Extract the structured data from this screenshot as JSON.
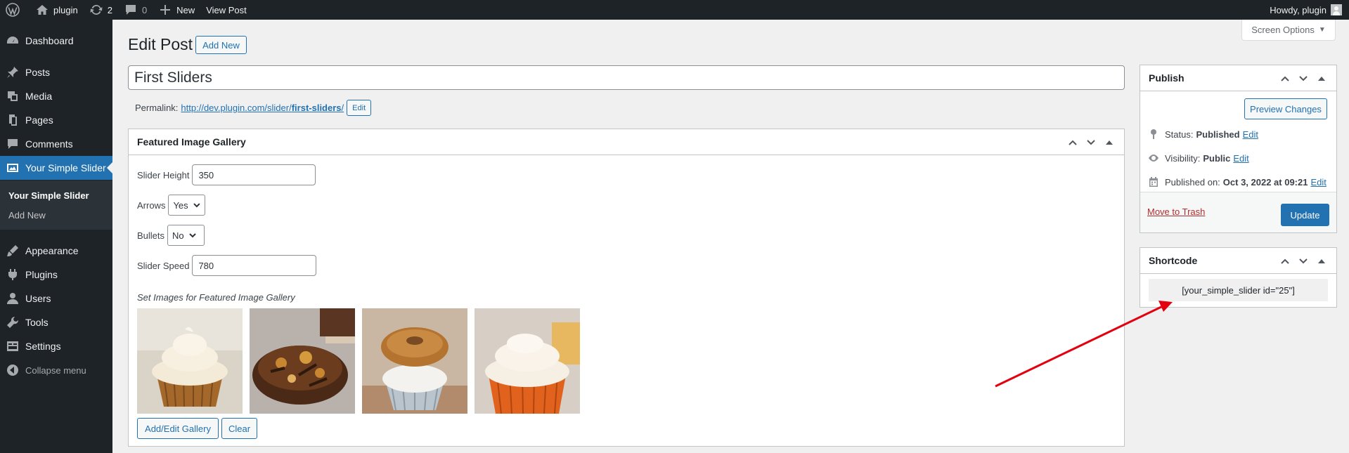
{
  "adminbar": {
    "site_name": "plugin",
    "updates_count": "2",
    "comments_count": "0",
    "new_label": "New",
    "view_post_label": "View Post",
    "howdy": "Howdy, plugin"
  },
  "sidebar": {
    "items": [
      {
        "label": "Dashboard",
        "icon": "dashboard-icon"
      },
      {
        "label": "Posts",
        "icon": "pin-icon"
      },
      {
        "label": "Media",
        "icon": "media-icon"
      },
      {
        "label": "Pages",
        "icon": "page-icon"
      },
      {
        "label": "Comments",
        "icon": "comment-icon"
      },
      {
        "label": "Your Simple Slider",
        "icon": "slider-icon",
        "current": true
      },
      {
        "label": "Appearance",
        "icon": "brush-icon"
      },
      {
        "label": "Plugins",
        "icon": "plugin-icon"
      },
      {
        "label": "Users",
        "icon": "user-icon"
      },
      {
        "label": "Tools",
        "icon": "wrench-icon"
      },
      {
        "label": "Settings",
        "icon": "settings-icon"
      }
    ],
    "submenu": [
      "Your Simple Slider",
      "Add New"
    ],
    "collapse_label": "Collapse menu"
  },
  "header": {
    "screen_options": "Screen Options",
    "page_title": "Edit Post",
    "add_new": "Add New"
  },
  "post": {
    "title": "First Sliders",
    "permalink_label": "Permalink:",
    "permalink_base": "http://dev.plugin.com/slider/",
    "permalink_slug": "first-sliders",
    "permalink_trailing": "/",
    "permalink_edit": "Edit"
  },
  "gallery": {
    "title": "Featured Image Gallery",
    "slider_height_label": "Slider Height",
    "slider_height_value": "350",
    "arrows_label": "Arrows",
    "arrows_value": "Yes",
    "bullets_label": "Bullets",
    "bullets_value": "No",
    "slider_speed_label": "Slider Speed",
    "slider_speed_value": "780",
    "images_note": "Set Images for Featured Image Gallery",
    "images": [
      "cupcake-vanilla-frosting",
      "chocolate-brownie-cookie",
      "donut-cupcake",
      "cupcake-orange-frosting"
    ],
    "add_edit_label": "Add/Edit Gallery",
    "clear_label": "Clear"
  },
  "publish": {
    "title": "Publish",
    "preview_label": "Preview Changes",
    "status_label": "Status:",
    "status_value": "Published",
    "visibility_label": "Visibility:",
    "visibility_value": "Public",
    "published_label": "Published on:",
    "published_value": "Oct 3, 2022 at 09:21",
    "edit_label": "Edit",
    "move_to_trash": "Move to Trash",
    "update_label": "Update"
  },
  "shortcode": {
    "title": "Shortcode",
    "value": "[your_simple_slider id=\"25\"]"
  },
  "colors": {
    "admin_dark": "#1d2327",
    "accent": "#2271b1",
    "trash": "#b32d2e",
    "annotation_arrow": "#e3000f"
  }
}
